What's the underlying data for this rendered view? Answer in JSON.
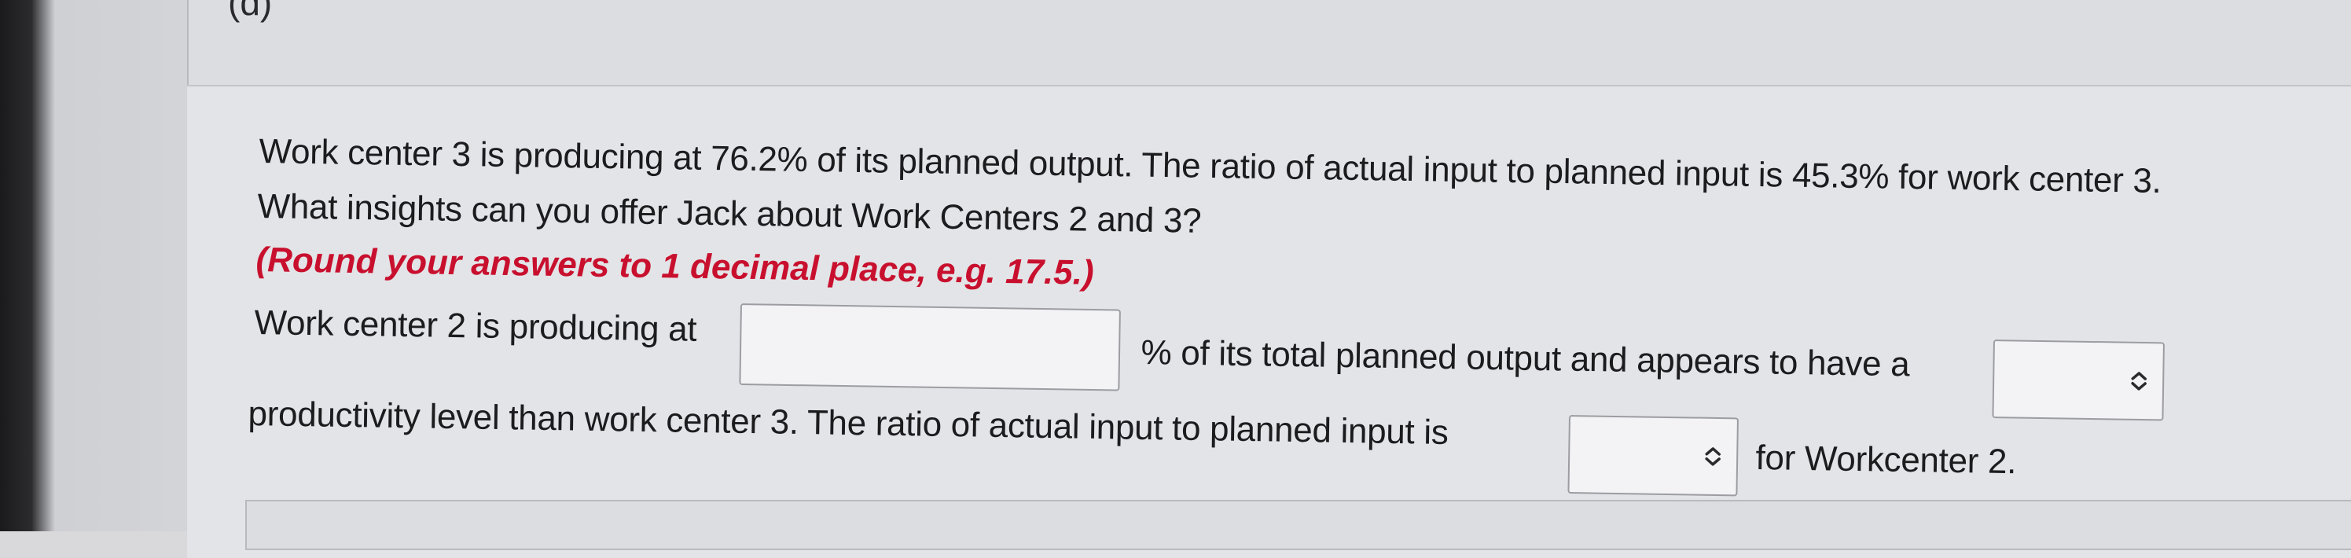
{
  "part": {
    "label": "(d)"
  },
  "question": {
    "line1": "Work center 3 is producing at 76.2% of its planned output. The ratio of actual input to planned input is 45.3% for work center 3.",
    "line2": "What insights can you offer Jack about Work Centers 2 and 3?",
    "hint": "(Round your answers to 1 decimal place, e.g. 17.5.)"
  },
  "answer": {
    "seg1": "Work center 2 is producing at",
    "input1_value": "",
    "seg2": "% of its total planned output and appears to have a",
    "select1_value": "",
    "seg3": "productivity level than work center 3. The ratio of actual input to planned input is",
    "select2_value": "",
    "seg4": "for Workcenter 2."
  },
  "colors": {
    "hint": "#c8102e",
    "text": "#1c1c1f",
    "field_border": "#9c9da2"
  },
  "icons": {
    "select_arrow": "updown-chevron-icon"
  }
}
